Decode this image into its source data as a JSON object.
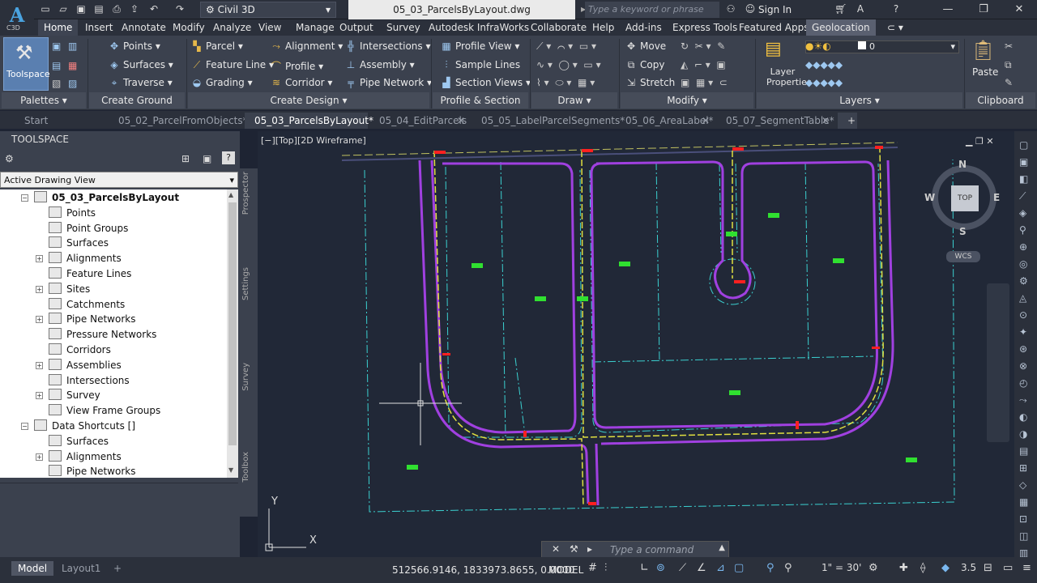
{
  "app": {
    "badge": "C3D",
    "workspace": "Civil 3D",
    "filename": "05_03_ParcelsByLayout.dwg",
    "search_placeholder": "Type a keyword or phrase",
    "signin": "Sign In"
  },
  "ribbon_tabs": [
    "Home",
    "Insert",
    "Annotate",
    "Modify",
    "Analyze",
    "View",
    "Manage",
    "Output",
    "Survey",
    "Autodesk InfraWorks",
    "Collaborate",
    "Help",
    "Add-ins",
    "Express Tools",
    "Featured Apps",
    "Geolocation"
  ],
  "ribbon": {
    "toolspace": "Toolspace",
    "palettes": "Palettes",
    "ground": [
      "Points",
      "Surfaces",
      "Traverse"
    ],
    "ground_panel": "Create Ground Data",
    "design": [
      "Parcel",
      "Feature Line",
      "Grading",
      "Alignment",
      "Profile",
      "Corridor",
      "Intersections",
      "Assembly",
      "Pipe Network"
    ],
    "design_panel": "Create Design",
    "profile": [
      "Profile View",
      "Sample Lines",
      "Section Views"
    ],
    "profile_panel": "Profile & Section Views",
    "draw_panel": "Draw",
    "modify": [
      "Move",
      "Copy",
      "Stretch"
    ],
    "modify_panel": "Modify",
    "layer_props": "Layer Properties",
    "layer_value": "0",
    "layers_panel": "Layers",
    "paste": "Paste",
    "clipboard_panel": "Clipboard"
  },
  "doc_tabs": [
    "Start",
    "05_02_ParcelFromObjects*",
    "05_03_ParcelsByLayout*",
    "05_04_EditParcels",
    "05_05_LabelParcelSegments*",
    "05_06_AreaLabel*",
    "05_07_SegmentTable*"
  ],
  "toolspace": {
    "title": "TOOLSPACE",
    "view": "Active Drawing View",
    "tree": [
      "05_03_ParcelsByLayout",
      "Points",
      "Point Groups",
      "Surfaces",
      "Alignments",
      "Feature Lines",
      "Sites",
      "Catchments",
      "Pipe Networks",
      "Pressure Networks",
      "Corridors",
      "Assemblies",
      "Intersections",
      "Survey",
      "View Frame Groups",
      "Data Shortcuts []",
      "Surfaces",
      "Alignments",
      "Pipe Networks"
    ],
    "side_tabs": [
      "Prospector",
      "Settings",
      "Survey",
      "Toolbox"
    ]
  },
  "viewport": {
    "label": "[−][Top][2D Wireframe]",
    "compass": {
      "n": "N",
      "s": "S",
      "e": "E",
      "w": "W",
      "top": "TOP",
      "wcs": "WCS"
    },
    "ucs_x": "X",
    "ucs_y": "Y"
  },
  "command": {
    "placeholder": "Type a command"
  },
  "status": {
    "coords": "512566.9146, 1833973.8655, 0.0000",
    "model": "MODEL",
    "scale": "1\" = 30'",
    "version": "3.5",
    "layouts": [
      "Model",
      "Layout1"
    ]
  }
}
